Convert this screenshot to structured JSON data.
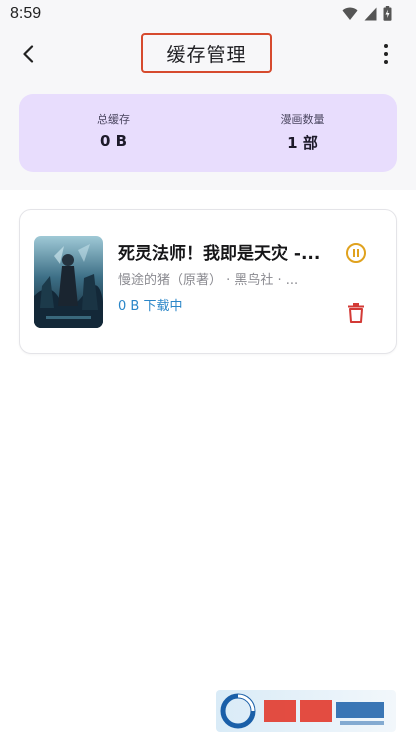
{
  "status_bar": {
    "time": "8:59"
  },
  "app_bar": {
    "title": "缓存管理"
  },
  "stats": {
    "total_cache_label": "总缓存",
    "total_cache_value": "0 B",
    "comic_count_label": "漫画数量",
    "comic_count_value": "1 部"
  },
  "downloads": [
    {
      "title": "死灵法师！我即是天灾 -...",
      "meta": "慢途的猪（原著） · 黑鸟社 · ...",
      "status": "0 B 下载中"
    }
  ],
  "icons": {
    "back": "arrow-back-icon",
    "more": "more-vertical-icon",
    "pause": "pause-circle-icon",
    "delete": "trash-icon"
  },
  "colors": {
    "stats_card_bg": "#e8ddfd",
    "title_highlight_border": "#d64a2e",
    "pause_icon": "#e0a21e",
    "delete_icon": "#d33a36",
    "status_text": "#2a86c8"
  }
}
